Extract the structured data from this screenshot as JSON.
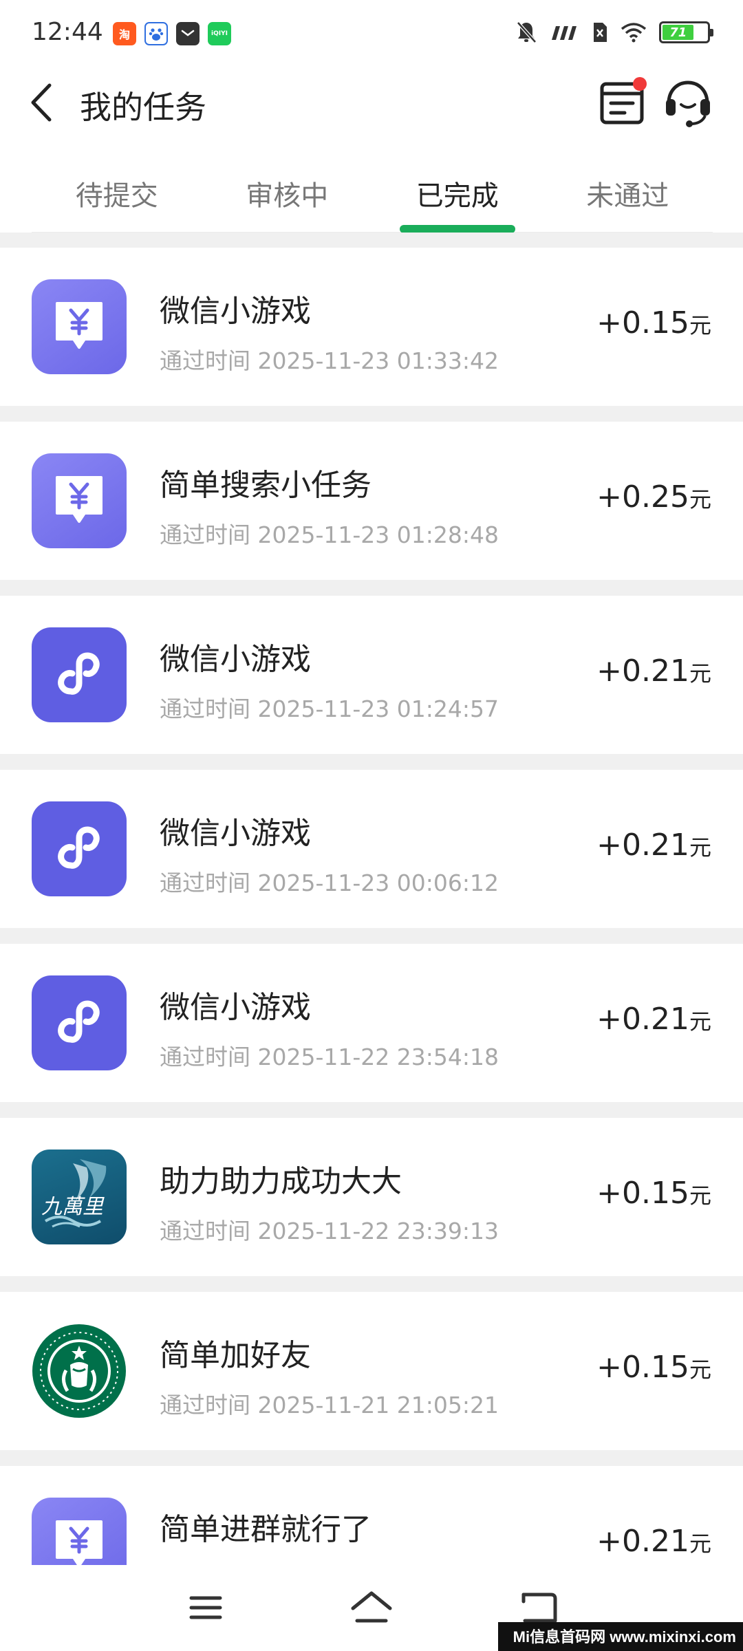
{
  "status_bar": {
    "time": "12:44",
    "app_icons": [
      "taobao-icon",
      "baidu-icon",
      "mail-icon",
      "iqiyi-icon"
    ],
    "battery_level": "71",
    "right_icons": [
      "mute-icon",
      "signal-icon",
      "sim-icon",
      "wifi-icon",
      "battery-icon"
    ]
  },
  "header": {
    "title": "我的任务",
    "back_icon": "chevron-left-icon",
    "list_icon": "list-box-icon",
    "service_icon": "headset-icon"
  },
  "tabs": [
    {
      "label": "待提交",
      "active": false
    },
    {
      "label": "审核中",
      "active": false
    },
    {
      "label": "已完成",
      "active": true
    },
    {
      "label": "未通过",
      "active": false
    }
  ],
  "colors": {
    "accent": "#1aad5a",
    "badge": "#f03a3a",
    "icon_purple": "#6c68e8",
    "separator": "#f0f0f0"
  },
  "tasks": [
    {
      "icon": "money-bubble-icon",
      "title": "微信小游戏",
      "time": "通过时间 2025-11-23 01:33:42",
      "amount": "+0.15",
      "unit": "元"
    },
    {
      "icon": "money-bubble-icon",
      "title": "简单搜索小任务",
      "time": "通过时间 2025-11-23 01:28:48",
      "amount": "+0.25",
      "unit": "元"
    },
    {
      "icon": "mini-program-icon",
      "title": "微信小游戏",
      "time": "通过时间 2025-11-23 01:24:57",
      "amount": "+0.21",
      "unit": "元"
    },
    {
      "icon": "mini-program-icon",
      "title": "微信小游戏",
      "time": "通过时间 2025-11-23 00:06:12",
      "amount": "+0.21",
      "unit": "元"
    },
    {
      "icon": "mini-program-icon",
      "title": "微信小游戏",
      "time": "通过时间 2025-11-22 23:54:18",
      "amount": "+0.21",
      "unit": "元"
    },
    {
      "icon": "jiuwanli-logo-icon",
      "icon_text": "九萬里",
      "title": "助力助力成功大大",
      "time": "通过时间 2025-11-22 23:39:13",
      "amount": "+0.15",
      "unit": "元"
    },
    {
      "icon": "starbucks-logo-icon",
      "title": "简单加好友",
      "time": "通过时间 2025-11-21 21:05:21",
      "amount": "+0.15",
      "unit": "元"
    },
    {
      "icon": "money-bubble-icon",
      "title": "简单进群就行了",
      "time": "",
      "amount": "+0.21",
      "unit": "元"
    }
  ],
  "nav_bar": {
    "menu_icon": "menu-icon",
    "home_icon": "home-icon",
    "back_icon": "back-icon"
  },
  "watermark": "Mi信息首码网 www.mixinxi.com"
}
